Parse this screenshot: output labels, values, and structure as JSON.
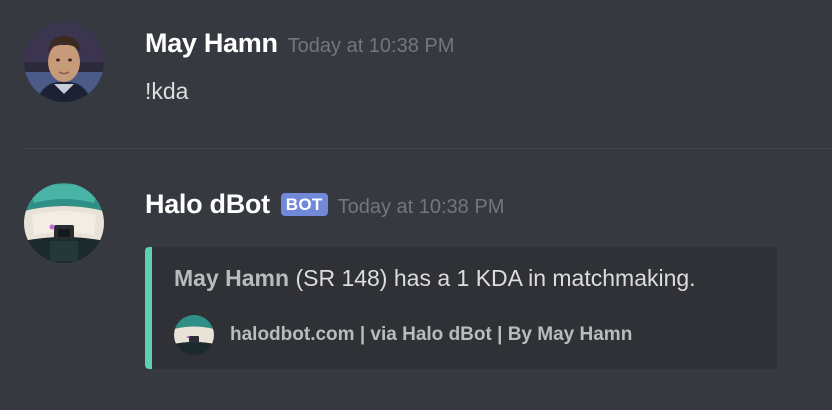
{
  "messages": [
    {
      "author": "May Hamn",
      "timestamp": "Today at 10:38 PM",
      "content": "!kda",
      "avatar_icon": "user-portrait-avatar"
    },
    {
      "author": "Halo dBot",
      "bot_tag": "BOT",
      "timestamp": "Today at 10:38 PM",
      "avatar_icon": "halo-helmet-avatar",
      "embed": {
        "accent_color": "#5ed0b2",
        "mention": "May Hamn",
        "description": "(SR 148) has a 1 KDA in matchmaking.",
        "footer_icon": "halo-helmet-icon",
        "footer_text": "halodbot.com | via Halo dBot | By May Hamn"
      }
    }
  ],
  "colors": {
    "background": "#36393f",
    "embed_background": "#2f3136",
    "bot_tag": "#7289da",
    "username": "#ffffff",
    "timestamp": "#72767d",
    "text": "#dcddde"
  }
}
